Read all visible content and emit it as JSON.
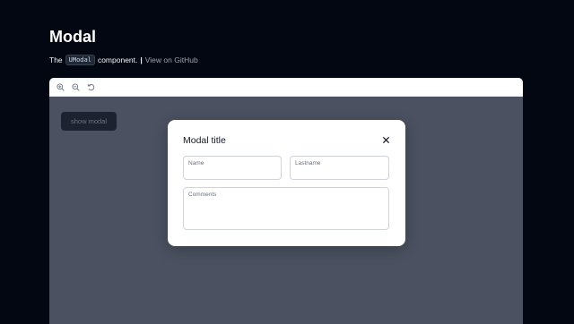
{
  "page": {
    "title": "Modal",
    "subtitle_prefix": "The",
    "component_code": "UModal",
    "subtitle_suffix": "component.",
    "separator": "|",
    "github_link": "View on GitHub"
  },
  "toolbar": {
    "zoom_in_icon": "zoom-in-icon",
    "zoom_out_icon": "zoom-out-icon",
    "reset_icon": "reset-icon"
  },
  "canvas": {
    "show_modal_label": "show modal"
  },
  "modal": {
    "title": "Modal title",
    "fields": {
      "name_label": "Name",
      "lastname_label": "Lastname",
      "comments_label": "Comments"
    }
  },
  "colors": {
    "page_bg": "#030712",
    "overlay_bg": "#4b5161",
    "modal_bg": "#ffffff"
  }
}
